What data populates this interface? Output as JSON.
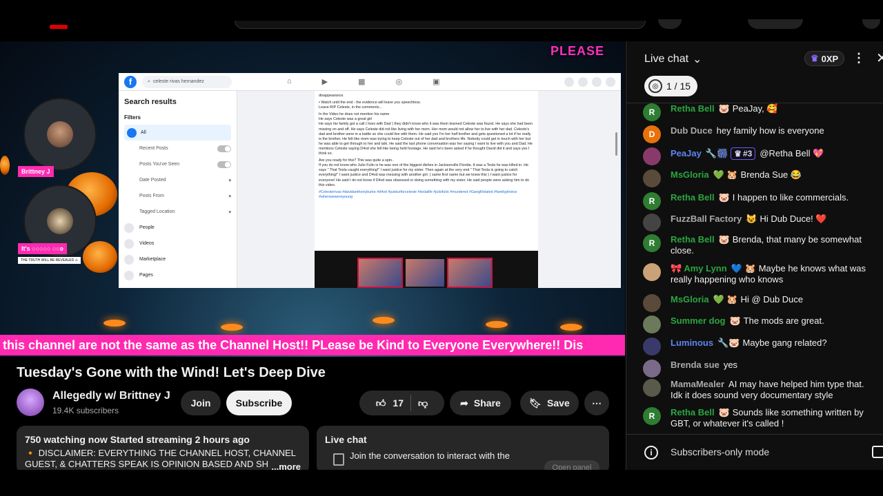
{
  "stream_overlay": {
    "hold_text": "PLEASE",
    "guest1_tag": "Brittney J",
    "guest2_tag": "It's ○○○○○ ○○ʚ",
    "guest2_sub": "THE TRUTH WILL BE REVEALED ⚠",
    "ticker": "this channel are not the same as the Channel Host!! PLease be Kind to Everyone Everywhere!!   Dis"
  },
  "facebook": {
    "search_query": "celeste rivas hernandez",
    "search_results_title": "Search results",
    "filters_label": "Filters",
    "filters": [
      "All",
      "Recent Posts",
      "Posts You've Seen",
      "Date Posted",
      "Posts From",
      "Tagged Location"
    ],
    "categories": [
      "People",
      "Videos",
      "Marketplace",
      "Pages"
    ],
    "post_paragraphs": [
      "disappearance.",
      "• Watch until the end - the evidence will leave you speechless.",
      "Leave RIP Celeste, in the comments...",
      "In the Video he does not mention his name",
      "He says Celeste was a great girl",
      "He says his family got a call ( lives with Dad ) they didn't know who it was them learned Celeste was found. He says she had been missing on and off. He says Celeste did not like living with her mom. Her mom would not allow her to live with her dad. Celeste's dad and brother were in a battle so she could live with them. He said yes I'm her half brother and gets questioned a lot if he really is the brother. He felt like mom was trying to keep Celeste out of her dad and brothers life. Nobody could get in touch with her but he was able to get through to her and talk. He said the last phone conversation was her saying I want to live with you and Dad. He mentions Celeste saying D4vd she felt like being held hostage. He said he's been asked if he thought David did it and says yes I think so.",
      "Are you ready for this? This was quite a spin..",
      "If you do not know who Julio Fulio is he was one of the biggest dishes in Jacksonville Florida. It was a Tesla he was killed in. He says \" That Tesla caught everything!\" I want justice for my sister. Then again at the very end \" That Tesla is going to catch everything!\" I want justice and D4vd was messing with another girl. ( same first name but we knew this ) I want justice for everyone! He said I do not know if D4vd was obsessed or doing something with my sister. He said people were asking him to do this video."
    ],
    "post_tags": "#Celesterivas #davidanthonyburke #d4vd #justiceforceleste #teslalife #juliofulio #murdered #GangRelated #familyphotos #whenwewereyoung"
  },
  "video": {
    "title": "Tuesday's Gone with the Wind! Let's Deep Dive",
    "channel_name": "Allegedly w/ Brittney J",
    "subscribers": "19.4K subscribers",
    "join_label": "Join",
    "subscribe_label": "Subscribe",
    "like_count": "17",
    "share_label": "Share",
    "save_label": "Save",
    "watching": "750 watching now  Started streaming 2 hours ago",
    "disclaimer": "🔸 DISCLAIMER: EVERYTHING THE CHANNEL HOST, CHANNEL GUEST, & CHATTERS SPEAK IS OPINION BASED AND SH",
    "more_label": "...more"
  },
  "chat_panel_small": {
    "title": "Live chat",
    "prompt": "Join the conversation to interact with the",
    "open_panel": "Open panel"
  },
  "chat": {
    "title": "Live chat",
    "xp": "0XP",
    "goal": "1 / 15",
    "footer": "Subscribers-only mode",
    "messages": [
      {
        "avatar": "R",
        "author": "Retha Bell",
        "badge": "🐷",
        "text": "PeaJay, 🥰"
      },
      {
        "avatar": "D",
        "author": "Dub Duce",
        "badge": "",
        "text": "hey family how is everyone"
      },
      {
        "avatar": "",
        "author": "PeaJay",
        "badge": "🔧🎆",
        "rank": "#3",
        "text": "@Retha Bell 💖"
      },
      {
        "avatar": "",
        "author": "MsGloria",
        "badge": "💚 🐹",
        "text": "Brenda Sue 😂"
      },
      {
        "avatar": "R",
        "author": "Retha Bell",
        "badge": "🐷",
        "text": "I happen to like commercials."
      },
      {
        "avatar": "",
        "author": "FuzzBall Factory",
        "badge": "😺",
        "text": "Hi Dub Duce! ❤️"
      },
      {
        "avatar": "R",
        "author": "Retha Bell",
        "badge": "🐷",
        "text": "Brenda, that many be somewhat close."
      },
      {
        "avatar": "",
        "author": "🎀 Amy Lynn",
        "badge": "💙 🐹",
        "text": "Maybe he knows what was really happening who knows"
      },
      {
        "avatar": "",
        "author": "MsGloria",
        "badge": "💚 🐹",
        "text": "Hi @ Dub Duce"
      },
      {
        "avatar": "",
        "author": "Summer dog",
        "badge": "🐷",
        "text": "The mods are great."
      },
      {
        "avatar": "",
        "author": "Luminous",
        "badge": "🔧🐷",
        "text": "Maybe gang related?"
      },
      {
        "avatar": "",
        "author": "Brenda sue",
        "badge": "",
        "text": "yes"
      },
      {
        "avatar": "",
        "author": "MamaMealer",
        "badge": "",
        "text": "AI may have helped him type that. Idk it does sound very documentary style"
      },
      {
        "avatar": "R",
        "author": "Retha Bell",
        "badge": "🐷",
        "text": "Sounds like something written by GBT, or whatever it's called !"
      }
    ]
  },
  "colors": {
    "chat_green": "#2ba640",
    "chat_blue": "#5e84f1",
    "ticker_pink": "#ff2ab0",
    "facebook_blue": "#1877f2"
  }
}
